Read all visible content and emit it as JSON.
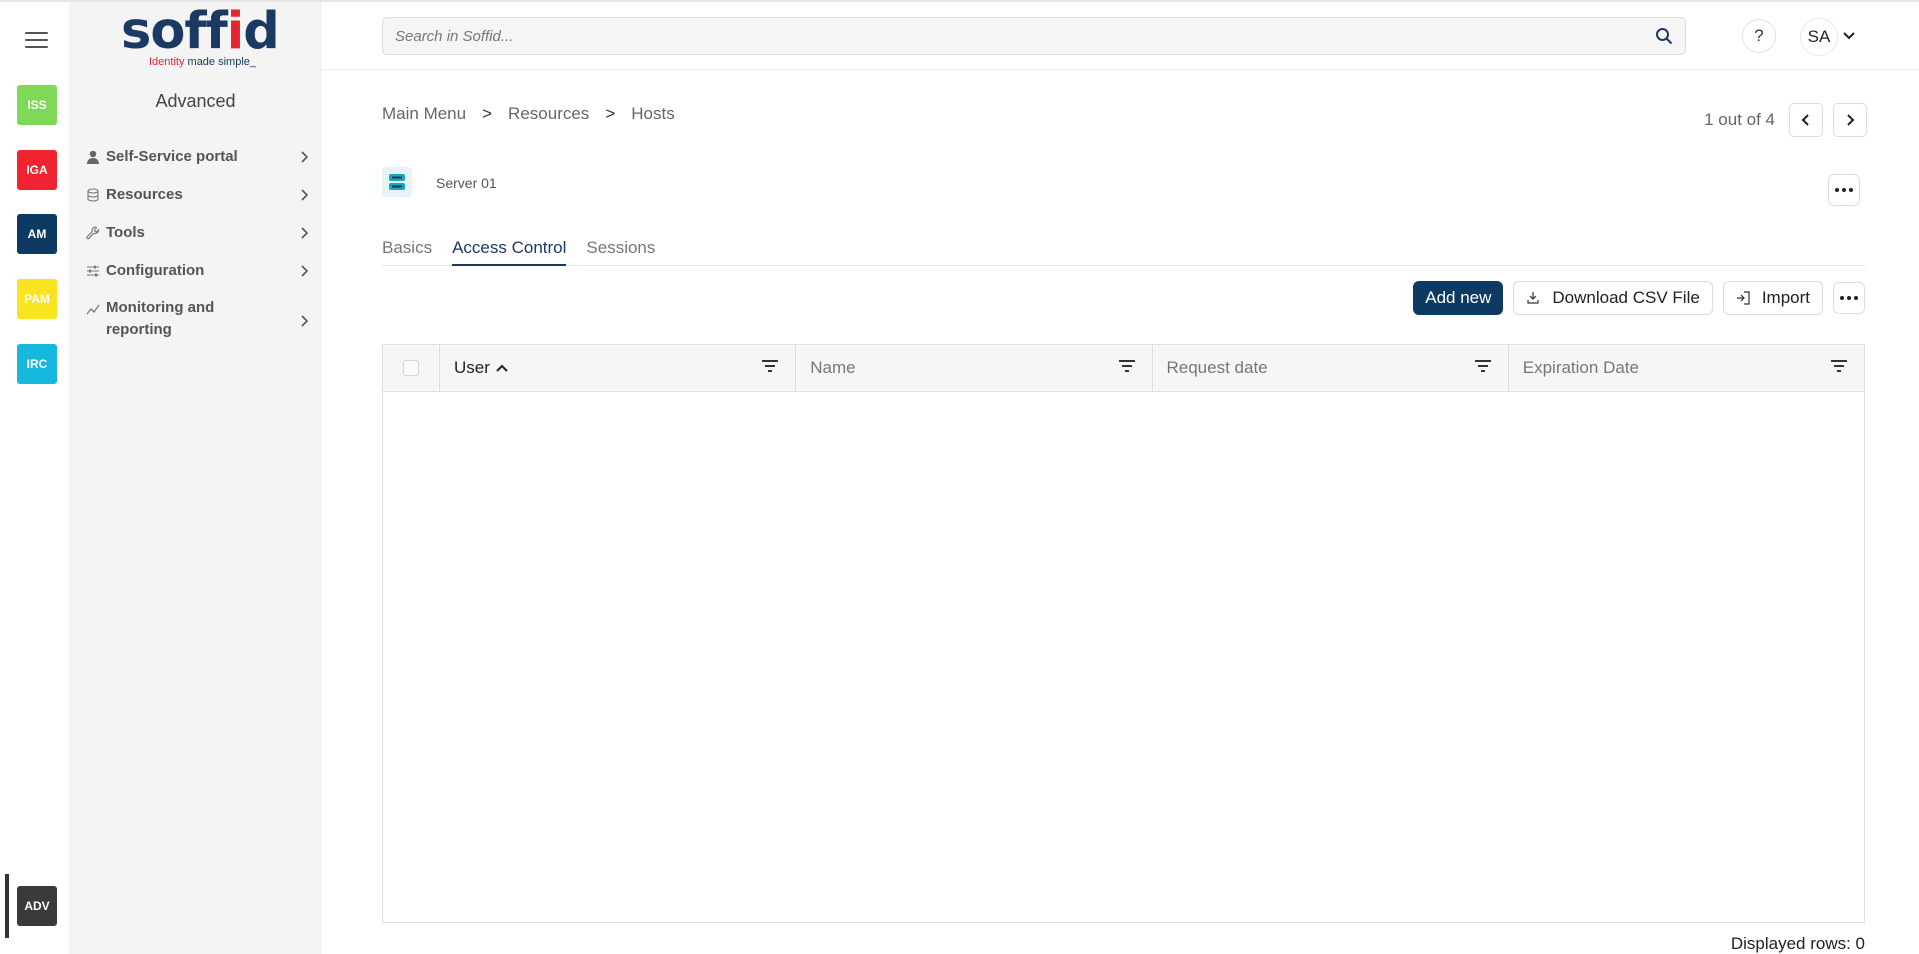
{
  "app": {
    "logo_text": "soffid",
    "logo_tagline_red": "Identity",
    "logo_tagline_rest": " made simple_",
    "brand_colors": {
      "navy": "#1b3a63",
      "red": "#e3262d",
      "primary_button": "#0d3a63"
    }
  },
  "rail": {
    "menu_icon": "hamburger-icon",
    "apps": [
      {
        "label": "ISS",
        "color": "#7ed957"
      },
      {
        "label": "IGA",
        "color": "#ef2430"
      },
      {
        "label": "AM",
        "color": "#0d3a63"
      },
      {
        "label": "PAM",
        "color": "#f8e51f"
      },
      {
        "label": "IRC",
        "color": "#16b8dd"
      },
      {
        "label": "ADV",
        "color": "#3a3a3a"
      }
    ]
  },
  "sidebar": {
    "title": "Advanced",
    "items": [
      {
        "label": "Self-Service portal",
        "icon": "user-icon"
      },
      {
        "label": "Resources",
        "icon": "database-icon"
      },
      {
        "label": "Tools",
        "icon": "wrench-icon"
      },
      {
        "label": "Configuration",
        "icon": "sliders-icon"
      },
      {
        "label": "Monitoring and reporting",
        "icon": "chart-line-icon"
      }
    ]
  },
  "header": {
    "search_placeholder": "Search in Soffid...",
    "help_label": "?",
    "user_initials": "SA"
  },
  "main": {
    "breadcrumb": [
      "Main Menu",
      "Resources",
      "Hosts"
    ],
    "breadcrumb_separator": ">",
    "pager_text": "1 out of 4",
    "host_name": "Server 01",
    "tabs": [
      {
        "label": "Basics",
        "active": false
      },
      {
        "label": "Access Control",
        "active": true
      },
      {
        "label": "Sessions",
        "active": false
      }
    ],
    "toolbar": {
      "add_label": "Add new",
      "download_label": "Download CSV File",
      "import_label": "Import"
    },
    "table": {
      "columns": [
        "User",
        "Name",
        "Request date",
        "Expiration Date"
      ],
      "sorted_column": "User",
      "sort_direction": "ascending",
      "rows": []
    },
    "footer_text": "Displayed rows: 0"
  }
}
